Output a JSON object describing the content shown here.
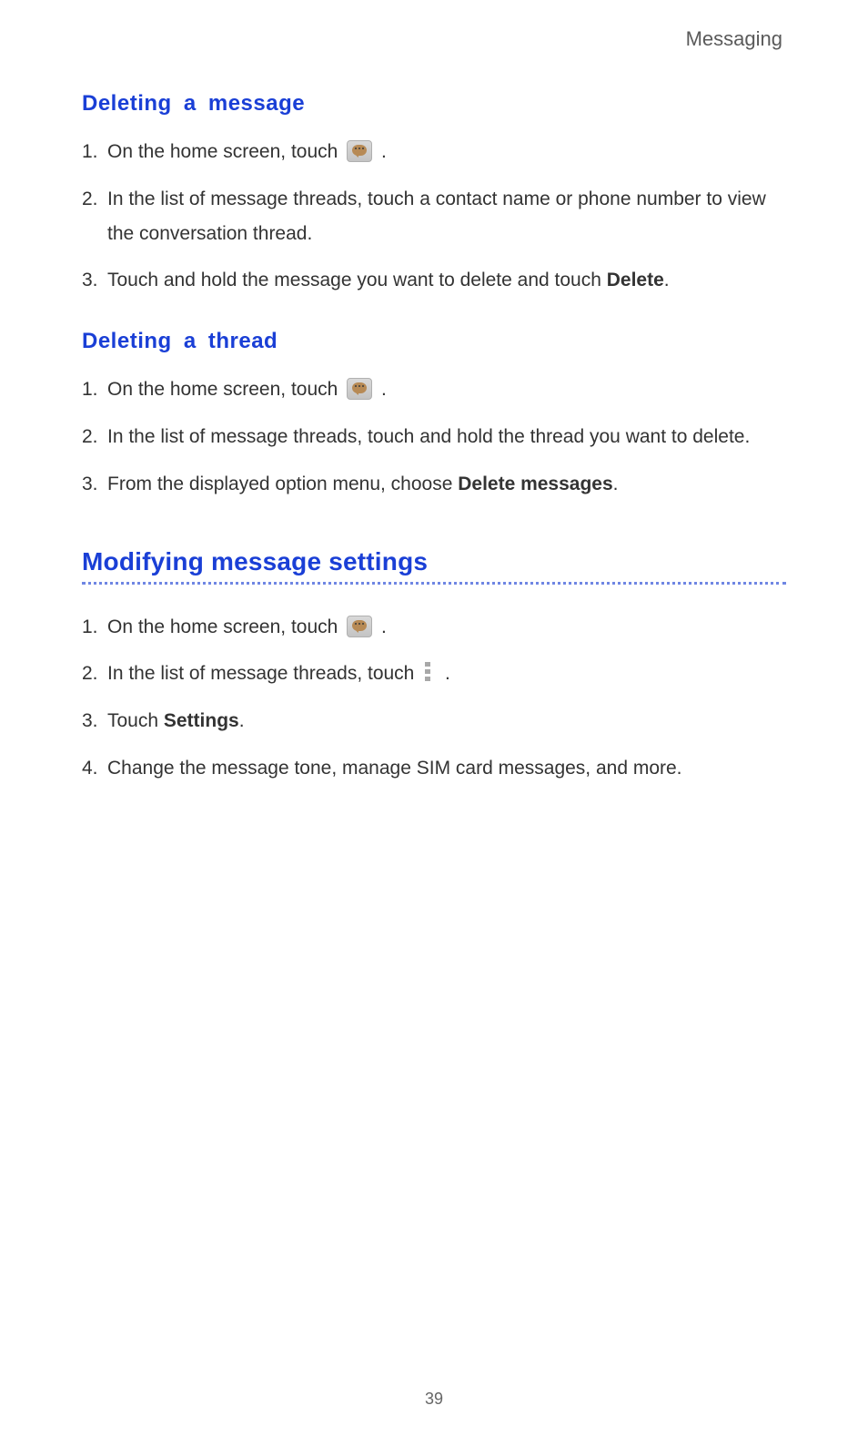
{
  "header": {
    "chapter": "Messaging"
  },
  "section1": {
    "heading": "Deleting  a  message",
    "steps": [
      {
        "num": "1.",
        "before": "On the home screen, touch ",
        "icon": "messaging",
        "after": " ."
      },
      {
        "num": "2.",
        "text": "In the list of message threads, touch a contact name or phone number to view the conversation thread."
      },
      {
        "num": "3.",
        "before": "Touch and hold the message you want to delete and touch ",
        "bold": "Delete",
        "after": "."
      }
    ]
  },
  "section2": {
    "heading": "Deleting  a  thread",
    "steps": [
      {
        "num": "1.",
        "before": "On the home screen, touch ",
        "icon": "messaging",
        "after": " ."
      },
      {
        "num": "2.",
        "text": "In the list of message threads, touch and hold the thread you want to delete."
      },
      {
        "num": "3.",
        "before": "From the displayed option menu, choose ",
        "bold": "Delete messages",
        "after": "."
      }
    ]
  },
  "section3": {
    "heading": "Modifying message settings",
    "steps": [
      {
        "num": "1.",
        "before": "On the home screen, touch ",
        "icon": "messaging",
        "after": " ."
      },
      {
        "num": "2.",
        "before": "In the list of message threads, touch ",
        "icon": "menu",
        "after": " ."
      },
      {
        "num": "3.",
        "before": "Touch ",
        "bold": "Settings",
        "after": "."
      },
      {
        "num": "4.",
        "text": "Change the message tone, manage SIM card messages, and more."
      }
    ]
  },
  "pageNumber": "39"
}
